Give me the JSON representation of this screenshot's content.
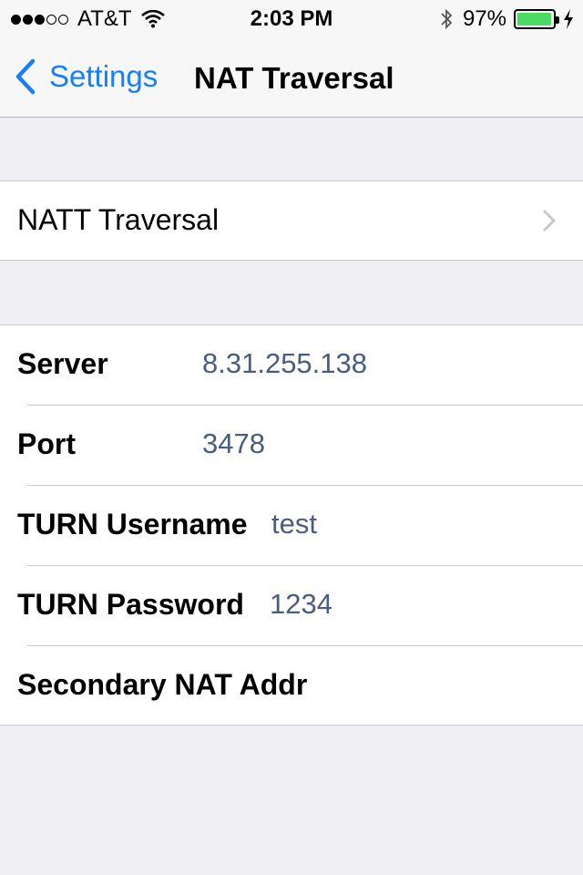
{
  "status_bar": {
    "signal_bars_filled": 3,
    "signal_bars_total": 5,
    "carrier": "AT&T",
    "wifi_icon": "wifi-icon",
    "time": "2:03 PM",
    "bluetooth_icon": "bluetooth-icon",
    "battery_percent": "97%",
    "battery_level": 0.97,
    "charging_icon": "bolt-icon"
  },
  "nav": {
    "back_label": "Settings",
    "title": "NAT Traversal"
  },
  "group1": {
    "item_label": "NATT Traversal"
  },
  "fields": {
    "server": {
      "label": "Server",
      "value": "8.31.255.138"
    },
    "port": {
      "label": "Port",
      "value": "3478"
    },
    "turn_username": {
      "label": "TURN Username",
      "value": "test"
    },
    "turn_password": {
      "label": "TURN Password",
      "value": "1234"
    },
    "secondary_nat": {
      "label": "Secondary NAT Addr",
      "value": ""
    }
  },
  "colors": {
    "accent": "#157efb",
    "value_text": "#4a5d7e",
    "background": "#efeff4",
    "battery_green": "#4cd964"
  }
}
